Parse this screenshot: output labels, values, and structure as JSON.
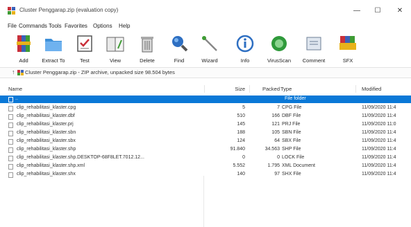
{
  "window": {
    "title": "Cluster Penggarap.zip (evaluation copy)",
    "minimize": "—",
    "maximize": "☐",
    "close": "✕"
  },
  "menu": [
    "File",
    "Commands",
    "Tools",
    "Favorites",
    "Options",
    "Help"
  ],
  "toolbar": [
    {
      "label": "Add",
      "icon": "archive-books-icon"
    },
    {
      "label": "Extract To",
      "icon": "folder-icon"
    },
    {
      "label": "Test",
      "icon": "test-checklist-icon"
    },
    {
      "label": "View",
      "icon": "view-book-icon"
    },
    {
      "label": "Delete",
      "icon": "trash-icon"
    },
    {
      "label": "Find",
      "icon": "magnifier-icon"
    },
    {
      "label": "Wizard",
      "icon": "wand-icon"
    },
    {
      "label": "Info",
      "icon": "info-icon"
    },
    {
      "label": "VirusScan",
      "icon": "virus-scan-icon"
    },
    {
      "label": "Comment",
      "icon": "comment-icon"
    },
    {
      "label": "SFX",
      "icon": "sfx-archive-icon"
    }
  ],
  "path": {
    "up": "↑",
    "text": "Cluster Penggarap.zip - ZIP archive, unpacked size 98.504 bytes"
  },
  "columns": {
    "name": "Name",
    "size": "Size",
    "packed": "Packed",
    "type": "Type",
    "modified": "Modified"
  },
  "rows": [
    {
      "name": "..",
      "size": "",
      "packed": "",
      "type": "File folder",
      "modified": "",
      "selected": true
    },
    {
      "name": "clip_rehabilitasi_klaster.cpg",
      "size": "5",
      "packed": "7",
      "type": "CPG File",
      "modified": "11/09/2020 11:4"
    },
    {
      "name": "clip_rehabilitasi_klaster.dbf",
      "size": "510",
      "packed": "166",
      "type": "DBF File",
      "modified": "11/09/2020 11:4"
    },
    {
      "name": "clip_rehabilitasi_klaster.prj",
      "size": "145",
      "packed": "121",
      "type": "PRJ File",
      "modified": "11/09/2020 11:0"
    },
    {
      "name": "clip_rehabilitasi_klaster.sbn",
      "size": "188",
      "packed": "105",
      "type": "SBN File",
      "modified": "11/09/2020 11:4"
    },
    {
      "name": "clip_rehabilitasi_klaster.sbx",
      "size": "124",
      "packed": "64",
      "type": "SBX File",
      "modified": "11/09/2020 11:4"
    },
    {
      "name": "clip_rehabilitasi_klaster.shp",
      "size": "91.840",
      "packed": "34.563",
      "type": "SHP File",
      "modified": "11/09/2020 11:4"
    },
    {
      "name": "clip_rehabilitasi_klaster.shp.DESKTOP-68F8LET.7012.12...",
      "size": "0",
      "packed": "0",
      "type": "LOCK File",
      "modified": "11/09/2020 11:4"
    },
    {
      "name": "clip_rehabilitasi_klaster.shp.xml",
      "size": "5.552",
      "packed": "1.795",
      "type": "XML Document",
      "modified": "11/09/2020 11:4"
    },
    {
      "name": "clip_rehabilitasi_klaster.shx",
      "size": "140",
      "packed": "97",
      "type": "SHX File",
      "modified": "11/09/2020 11:4"
    }
  ],
  "colors": {
    "selection": "#0a78d7",
    "brand_red": "#c9303a",
    "brand_blue": "#3a62b9",
    "brand_green": "#3f9c35",
    "brand_yellow": "#e8b21a"
  }
}
